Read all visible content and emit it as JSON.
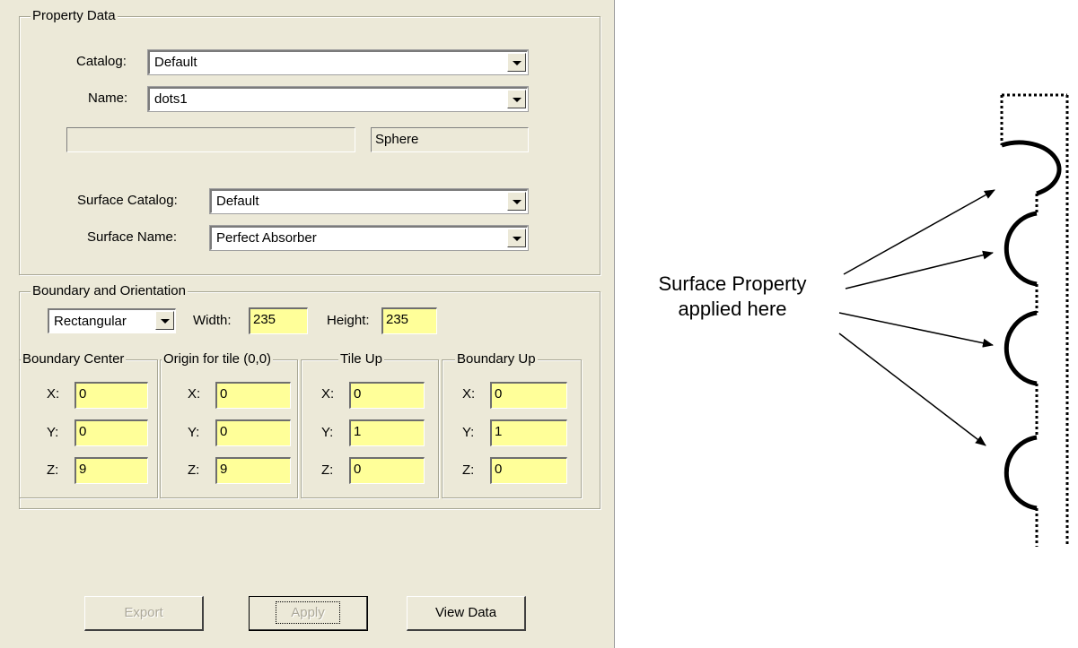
{
  "property_data": {
    "title": "Property Data",
    "catalog_label": "Catalog:",
    "catalog_value": "Default",
    "name_label": "Name:",
    "name_value": "dots1",
    "description_value": "",
    "type_value": "Sphere",
    "surface_catalog_label": "Surface Catalog:",
    "surface_catalog_value": "Default",
    "surface_name_label": "Surface Name:",
    "surface_name_value": "Perfect Absorber"
  },
  "boundary": {
    "title": "Boundary and Orientation",
    "shape_value": "Rectangular",
    "width_label": "Width:",
    "width_value": "235",
    "height_label": "Height:",
    "height_value": "235",
    "groups": [
      {
        "title": "Boundary Center",
        "x": "0",
        "y": "0",
        "z": "9"
      },
      {
        "title": "Origin for tile (0,0)",
        "x": "0",
        "y": "0",
        "z": "9"
      },
      {
        "title": "Tile Up",
        "x": "0",
        "y": "1",
        "z": "0"
      },
      {
        "title": "Boundary Up",
        "x": "0",
        "y": "1",
        "z": "0"
      }
    ],
    "axis_labels": {
      "x": "X:",
      "y": "Y:",
      "z": "Z:"
    }
  },
  "buttons": {
    "export": "Export",
    "apply": "Apply",
    "view_data": "View Data"
  },
  "annotation": {
    "line1": "Surface Property",
    "line2": "applied here"
  }
}
